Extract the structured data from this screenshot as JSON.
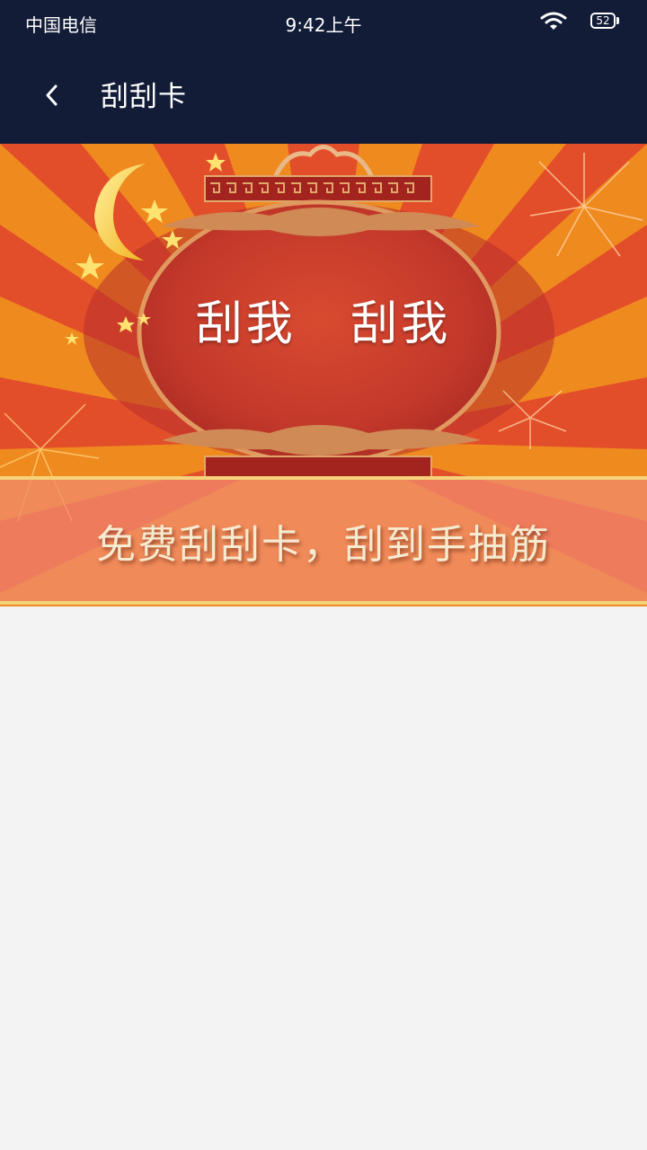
{
  "status_bar": {
    "carrier": "中国电信",
    "time": "9:42上午",
    "battery_level": "52",
    "wifi_icon": "wifi-icon"
  },
  "app_bar": {
    "back_icon": "chevron-left-icon",
    "title": "刮刮卡"
  },
  "banner": {
    "scratch_label_1": "刮我",
    "scratch_label_2": "刮我",
    "promo_text": "免费刮刮卡，刮到手抽筋",
    "colors": {
      "orange": "#ef8a1f",
      "red": "#e04a2c",
      "lantern_red": "#c93a2a",
      "gold": "#d9a05a"
    }
  },
  "colors": {
    "header_bg": "#121c37",
    "page_bg": "#f2f3f2"
  }
}
